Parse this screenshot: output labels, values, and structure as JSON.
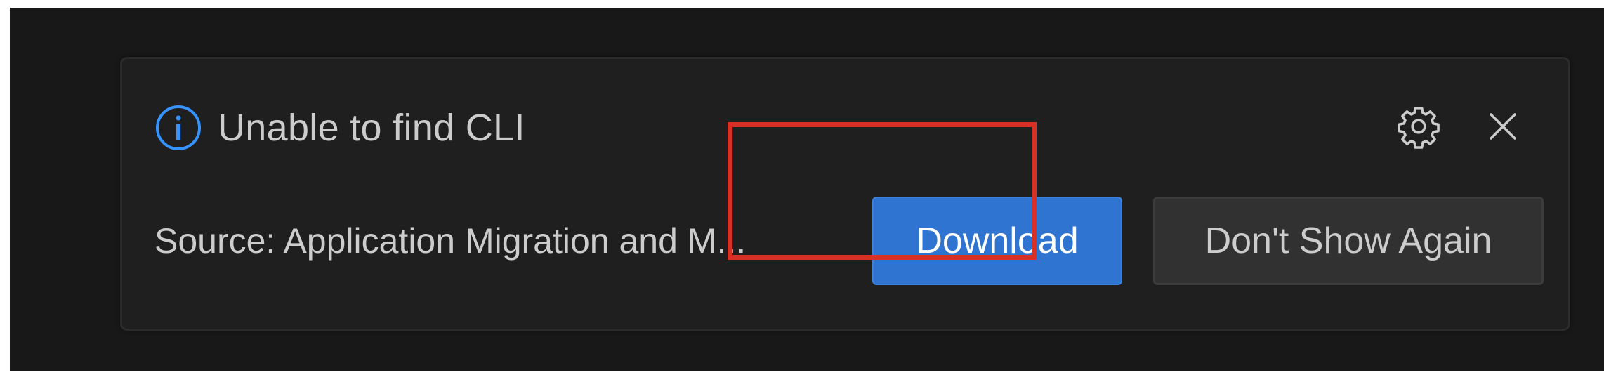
{
  "notification": {
    "title": "Unable to find CLI",
    "source": "Source: Application Migration and M...",
    "primary_action": "Download",
    "secondary_action": "Don't Show Again",
    "icons": {
      "info": "info-icon",
      "settings": "gear-icon",
      "close": "close-icon"
    }
  },
  "colors": {
    "background": "#181818",
    "toast_background": "#1f1f1f",
    "primary_button": "#2f74d0",
    "info_icon": "#3794ff",
    "highlight_box": "#d93025"
  }
}
